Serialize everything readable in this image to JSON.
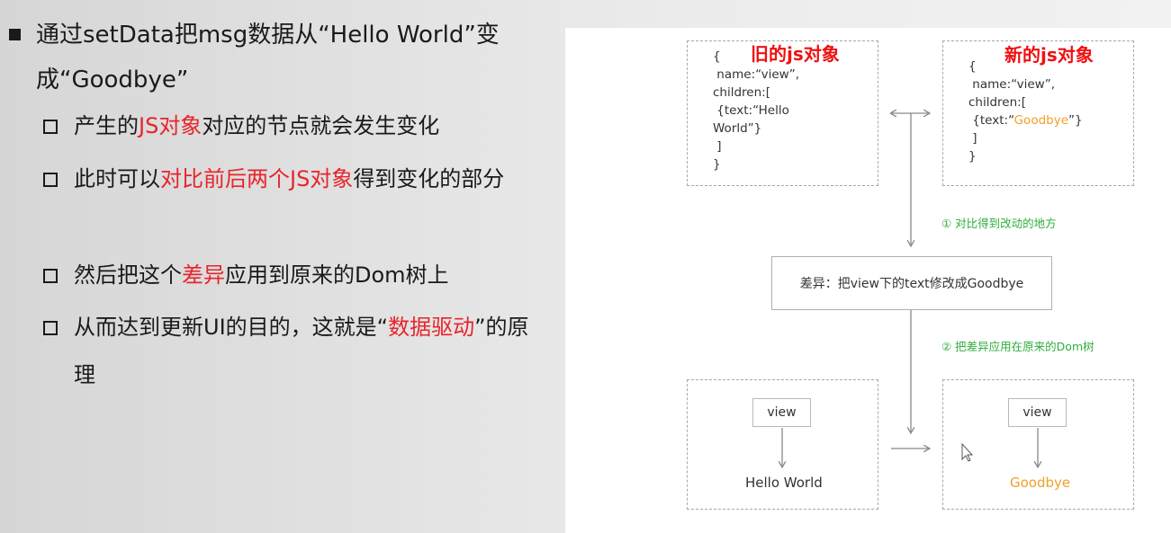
{
  "left": {
    "main_bullet": {
      "text": "通过setData把msg数据从“Hello World”变成“Goodbye”"
    },
    "items": [
      {
        "pre": "产生的",
        "red": "JS对象",
        "post": "对应的节点就会发生变化"
      },
      {
        "pre": "此时可以",
        "red": "对比前后两个JS对象",
        "post": "得到变化的部分"
      },
      {
        "pre": "然后把这个",
        "red": "差异",
        "post": "应用到原来的Dom树上"
      },
      {
        "pre": "从而达到更新UI的目的，这就是“",
        "red": "数据驱动",
        "post": "”的原理"
      }
    ]
  },
  "diagram": {
    "old_heading": "旧的js对象",
    "new_heading": "新的js对象",
    "old_code": {
      "l1": "{",
      "l2": " name:“view”,",
      "l3": "children:[",
      "l4": " {text:“Hello",
      "l5": "World”}",
      "l6": " ]",
      "l7": "}"
    },
    "new_code": {
      "l1": "{",
      "l2": " name:“view”,",
      "l3": "children:[",
      "l4_pre": " {text:“",
      "l4_orange": "Goodbye",
      "l4_post": "”}",
      "l5": " ]",
      "l6": "}"
    },
    "step1": "① 对比得到改动的地方",
    "diff_label": "差异：把view下的text修改成Goodbye",
    "step2": "② 把差异应用在原来的Dom树",
    "tree_old": {
      "node": "view",
      "leaf": "Hello World"
    },
    "tree_new": {
      "node": "view",
      "leaf": "Goodbye"
    },
    "colors": {
      "heading_red": "#f01010",
      "step_green": "#2fae3c",
      "goodbye_orange": "#f0a02a",
      "highlight_red": "#e8242a"
    }
  }
}
